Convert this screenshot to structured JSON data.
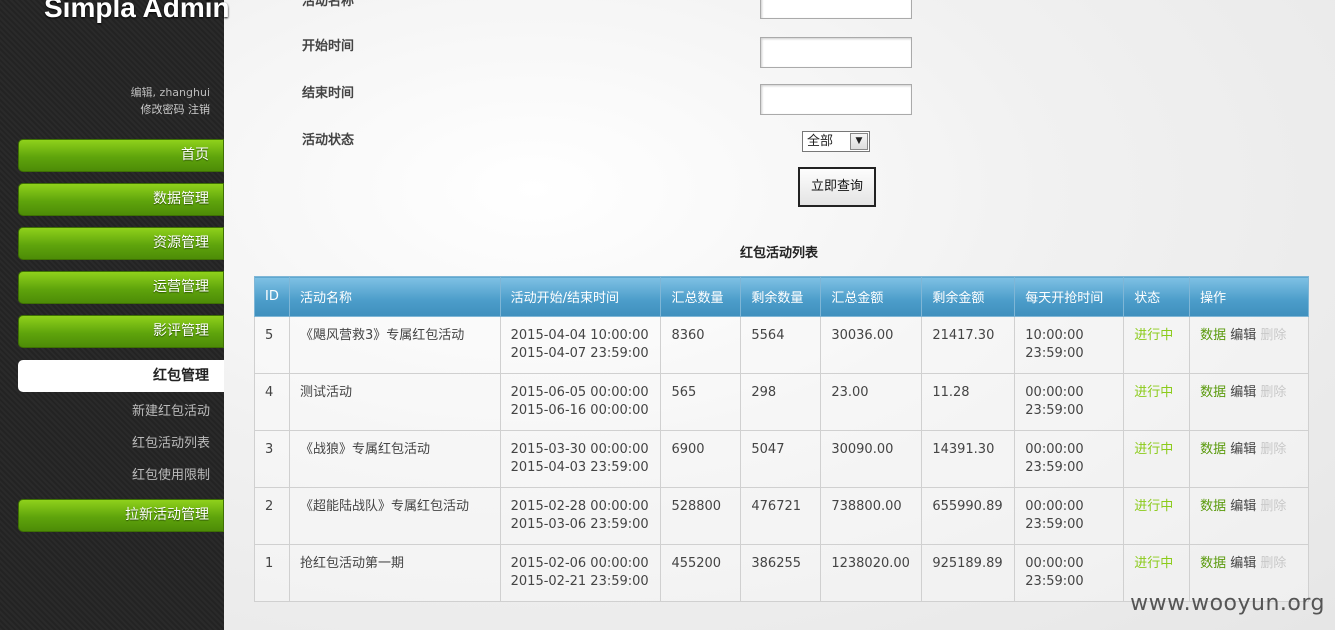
{
  "app": {
    "title": "Simpla Admin"
  },
  "profile": {
    "greeting": "编辑, zhanghui",
    "change_password": "修改密码",
    "logout": "注销"
  },
  "nav": {
    "home": "首页",
    "data_mgmt": "数据管理",
    "resource_mgmt": "资源管理",
    "ops_mgmt": "运营管理",
    "review_mgmt": "影评管理",
    "redpacket_mgmt": "红包管理",
    "sub": {
      "new_activity": "新建红包活动",
      "activity_list": "红包活动列表",
      "usage_limit": "红包使用限制"
    },
    "invite_mgmt": "拉新活动管理"
  },
  "search_form": {
    "name_label": "活动名称",
    "start_label": "开始时间",
    "end_label": "结束时间",
    "status_label": "活动状态",
    "status_selected": "全部",
    "submit_label": "立即查询"
  },
  "list_title": "红包活动列表",
  "table": {
    "headers": [
      "ID",
      "活动名称",
      "活动开始/结束时间",
      "汇总数量",
      "剩余数量",
      "汇总金额",
      "剩余金额",
      "每天开抢时间",
      "状态",
      "操作"
    ],
    "rows": [
      {
        "id": "5",
        "name": "《飓风营救3》专属红包活动",
        "start": "2015-04-04 10:00:00",
        "end": "2015-04-07 23:59:00",
        "total_qty": "8360",
        "remain_qty": "5564",
        "total_amt": "30036.00",
        "remain_amt": "21417.30",
        "daily_start": "10:00:00",
        "daily_end": "23:59:00",
        "status": "进行中"
      },
      {
        "id": "4",
        "name": "测试活动",
        "start": "2015-06-05 00:00:00",
        "end": "2015-06-16 00:00:00",
        "total_qty": "565",
        "remain_qty": "298",
        "total_amt": "23.00",
        "remain_amt": "11.28",
        "daily_start": "00:00:00",
        "daily_end": "23:59:00",
        "status": "进行中"
      },
      {
        "id": "3",
        "name": "《战狼》专属红包活动",
        "start": "2015-03-30 00:00:00",
        "end": "2015-04-03 23:59:00",
        "total_qty": "6900",
        "remain_qty": "5047",
        "total_amt": "30090.00",
        "remain_amt": "14391.30",
        "daily_start": "00:00:00",
        "daily_end": "23:59:00",
        "status": "进行中"
      },
      {
        "id": "2",
        "name": "《超能陆战队》专属红包活动",
        "start": "2015-02-28 00:00:00",
        "end": "2015-03-06 23:59:00",
        "total_qty": "528800",
        "remain_qty": "476721",
        "total_amt": "738800.00",
        "remain_amt": "655990.89",
        "daily_start": "00:00:00",
        "daily_end": "23:59:00",
        "status": "进行中"
      },
      {
        "id": "1",
        "name": "抢红包活动第一期",
        "start": "2015-02-06 00:00:00",
        "end": "2015-02-21 23:59:00",
        "total_qty": "455200",
        "remain_qty": "386255",
        "total_amt": "1238020.00",
        "remain_amt": "925189.89",
        "daily_start": "00:00:00",
        "daily_end": "23:59:00",
        "status": "进行中"
      }
    ],
    "actions": {
      "data": "数据",
      "edit": "编辑",
      "delete": "删除"
    }
  },
  "watermark": "www.wooyun.org",
  "colors": {
    "accent_green": "#5fa40c",
    "header_blue": "#4b9cc9",
    "status_green": "#8bcb1a"
  }
}
